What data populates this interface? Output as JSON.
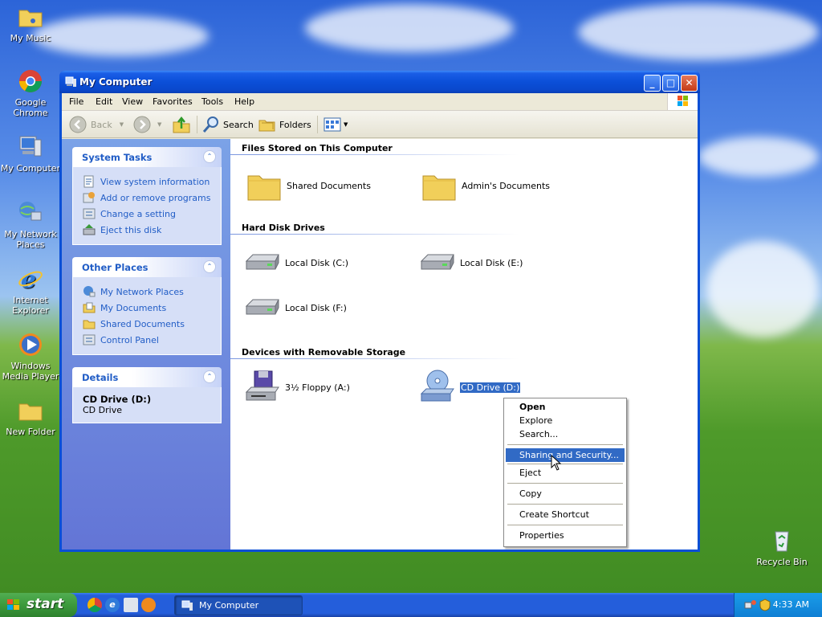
{
  "desktop": {
    "icons": [
      {
        "label": "My Music"
      },
      {
        "label": "Google Chrome"
      },
      {
        "label": "My Computer"
      },
      {
        "label": "My Network Places"
      },
      {
        "label": "Internet Explorer"
      },
      {
        "label": "Windows Media Player"
      },
      {
        "label": "New Folder"
      },
      {
        "label": "Recycle Bin"
      }
    ]
  },
  "window": {
    "title": "My Computer",
    "buttons": {
      "minimize": "_",
      "maximize": "□",
      "close": "✕"
    },
    "menu": [
      "File",
      "Edit",
      "View",
      "Favorites",
      "Tools",
      "Help"
    ],
    "toolbar": {
      "back": "Back",
      "search": "Search",
      "folders": "Folders"
    }
  },
  "left_pane": {
    "system_tasks": {
      "title": "System Tasks",
      "items": [
        "View system information",
        "Add or remove programs",
        "Change a setting",
        "Eject this disk"
      ]
    },
    "other_places": {
      "title": "Other Places",
      "items": [
        "My Network Places",
        "My Documents",
        "Shared Documents",
        "Control Panel"
      ]
    },
    "details": {
      "title": "Details",
      "name": "CD Drive (D:)",
      "type": "CD Drive"
    }
  },
  "content": {
    "groups": [
      {
        "title": "Files Stored on This Computer",
        "items": [
          "Shared Documents",
          "Admin's Documents"
        ]
      },
      {
        "title": "Hard Disk Drives",
        "items": [
          "Local Disk (C:)",
          "Local Disk (E:)",
          "Local Disk (F:)"
        ]
      },
      {
        "title": "Devices with Removable Storage",
        "items": [
          "3½ Floppy (A:)",
          "CD Drive (D:)"
        ]
      }
    ]
  },
  "context_menu": {
    "items": [
      "Open",
      "Explore",
      "Search...",
      "Sharing and Security...",
      "Eject",
      "Copy",
      "Create Shortcut",
      "Properties"
    ],
    "highlighted": "Sharing and Security..."
  },
  "taskbar": {
    "start": "start",
    "task": "My Computer",
    "clock": "4:33 AM"
  },
  "colors": {
    "titlebar": "#0a4fd6",
    "task_pane_link": "#215dc6",
    "selection": "#316ac5",
    "start_green": "#3c9a3c"
  }
}
